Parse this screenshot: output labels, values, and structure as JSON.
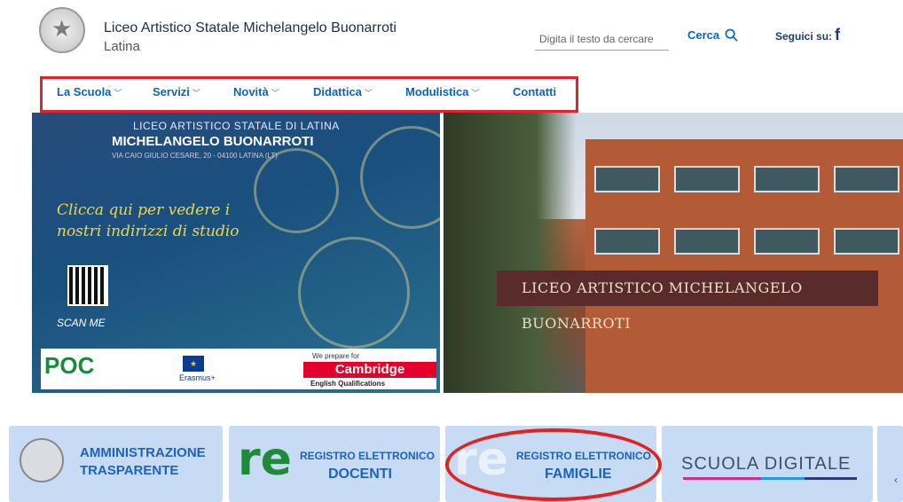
{
  "header": {
    "school_name": "Liceo Artistico Statale Michelangelo Buonarroti",
    "city": "Latina",
    "search_placeholder": "Digita il testo da cercare",
    "search_button": "Cerca",
    "follow_label": "Seguici su:"
  },
  "nav": {
    "items": [
      {
        "label": "La Scuola",
        "has_dropdown": true
      },
      {
        "label": "Servizi",
        "has_dropdown": true
      },
      {
        "label": "Novità",
        "has_dropdown": true
      },
      {
        "label": "Didattica",
        "has_dropdown": true
      },
      {
        "label": "Modulistica",
        "has_dropdown": true
      },
      {
        "label": "Contatti",
        "has_dropdown": false
      }
    ]
  },
  "hero": {
    "poster_title_top": "LICEO ARTISTICO STATALE DI LATINA",
    "poster_title_main": "MICHELANGELO BUONARROTI",
    "poster_address": "VIA CAIO GIULIO CESARE, 20 - 04100 LATINA (LT)",
    "poster_tagline": "Clicca qui per vedere i nostri indirizzi di studio",
    "scan_label": "SCAN ME",
    "logo_poc": "POC",
    "logo_erasmus": "Erasmus+",
    "cambridge_top": "We prepare for",
    "cambridge_main": "Cambridge",
    "cambridge_bottom": "English Qualifications",
    "building_banner": "LICEO ARTISTICO MICHELANGELO BUONARROTI"
  },
  "shortcuts": [
    {
      "line1": "AMMINISTRAZIONE",
      "line2": "TRASPARENTE"
    },
    {
      "line1": "REGISTRO ELETTRONICO",
      "line2": "DOCENTI"
    },
    {
      "line1": "REGISTRO ELETTRONICO",
      "line2": "FAMIGLIE"
    },
    {
      "line1": "SCUOLA DIGITALE",
      "line2": ""
    }
  ],
  "colors": {
    "nav_text": "#0a66b2",
    "highlight_red": "#e5202f",
    "card_bg": "#c7dbf4",
    "card_text": "#1d63b7"
  },
  "icons": [
    "emblem-icon",
    "search-icon",
    "facebook-icon",
    "chevron-down-icon",
    "re-logo-icon"
  ]
}
